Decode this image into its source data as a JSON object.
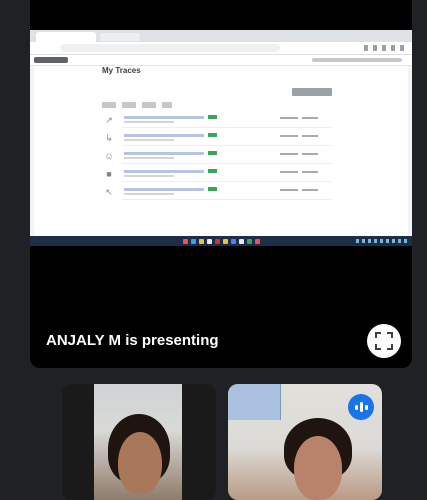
{
  "shared_screen": {
    "page_title": "My Traces",
    "control_button": "",
    "trace_icons": [
      "arrow-icon",
      "chart-icon",
      "people-icon",
      "car-icon",
      "cursor-icon"
    ]
  },
  "presenter": {
    "label": "ANJALY M is presenting"
  },
  "participants": [
    {
      "name": ""
    },
    {
      "name": "",
      "speaking": true
    }
  ],
  "colors": {
    "background": "#202124",
    "speaking_accent": "#1a73e8"
  }
}
